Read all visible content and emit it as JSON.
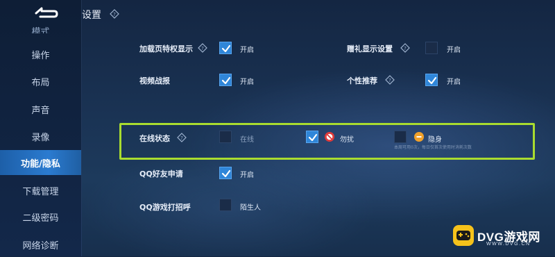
{
  "header": {
    "title": "设置"
  },
  "sidebar": {
    "partial_item": "模式",
    "items": [
      {
        "label": "操作"
      },
      {
        "label": "布局"
      },
      {
        "label": "声音"
      },
      {
        "label": "录像"
      },
      {
        "label": "功能/隐私"
      },
      {
        "label": "下载管理"
      },
      {
        "label": "二级密码"
      },
      {
        "label": "网络诊断"
      }
    ],
    "active_index": 4
  },
  "settings": {
    "loading_privilege": {
      "label": "加载页特权显示",
      "checked": true,
      "option": "开启"
    },
    "gift_display": {
      "label": "赠礼显示设置",
      "checked": false,
      "option": "开启"
    },
    "video_report": {
      "label": "视频战报",
      "checked": true,
      "option": "开启"
    },
    "personal_recommend": {
      "label": "个性推荐",
      "checked": true,
      "option": "开启"
    },
    "online_status": {
      "label": "在线状态",
      "options": [
        {
          "label": "在线",
          "checked": false
        },
        {
          "label": "勿扰",
          "checked": true
        },
        {
          "label": "隐身",
          "checked": false
        }
      ],
      "note": "本周可用0次，每日仅首次使用时消耗次数"
    },
    "qq_friend_request": {
      "label": "QQ好友申请",
      "checked": true,
      "option": "开启"
    },
    "qq_game_greeting": {
      "label": "QQ游戏打招呼",
      "checked": false,
      "option": "陌生人"
    }
  },
  "watermark": {
    "brand": "DVG游戏网",
    "url": "WWW.DVG.CN"
  },
  "colors": {
    "accent": "#2f86d9",
    "highlight": "#a9dc2f",
    "active_tab": "#2b7bd0"
  }
}
